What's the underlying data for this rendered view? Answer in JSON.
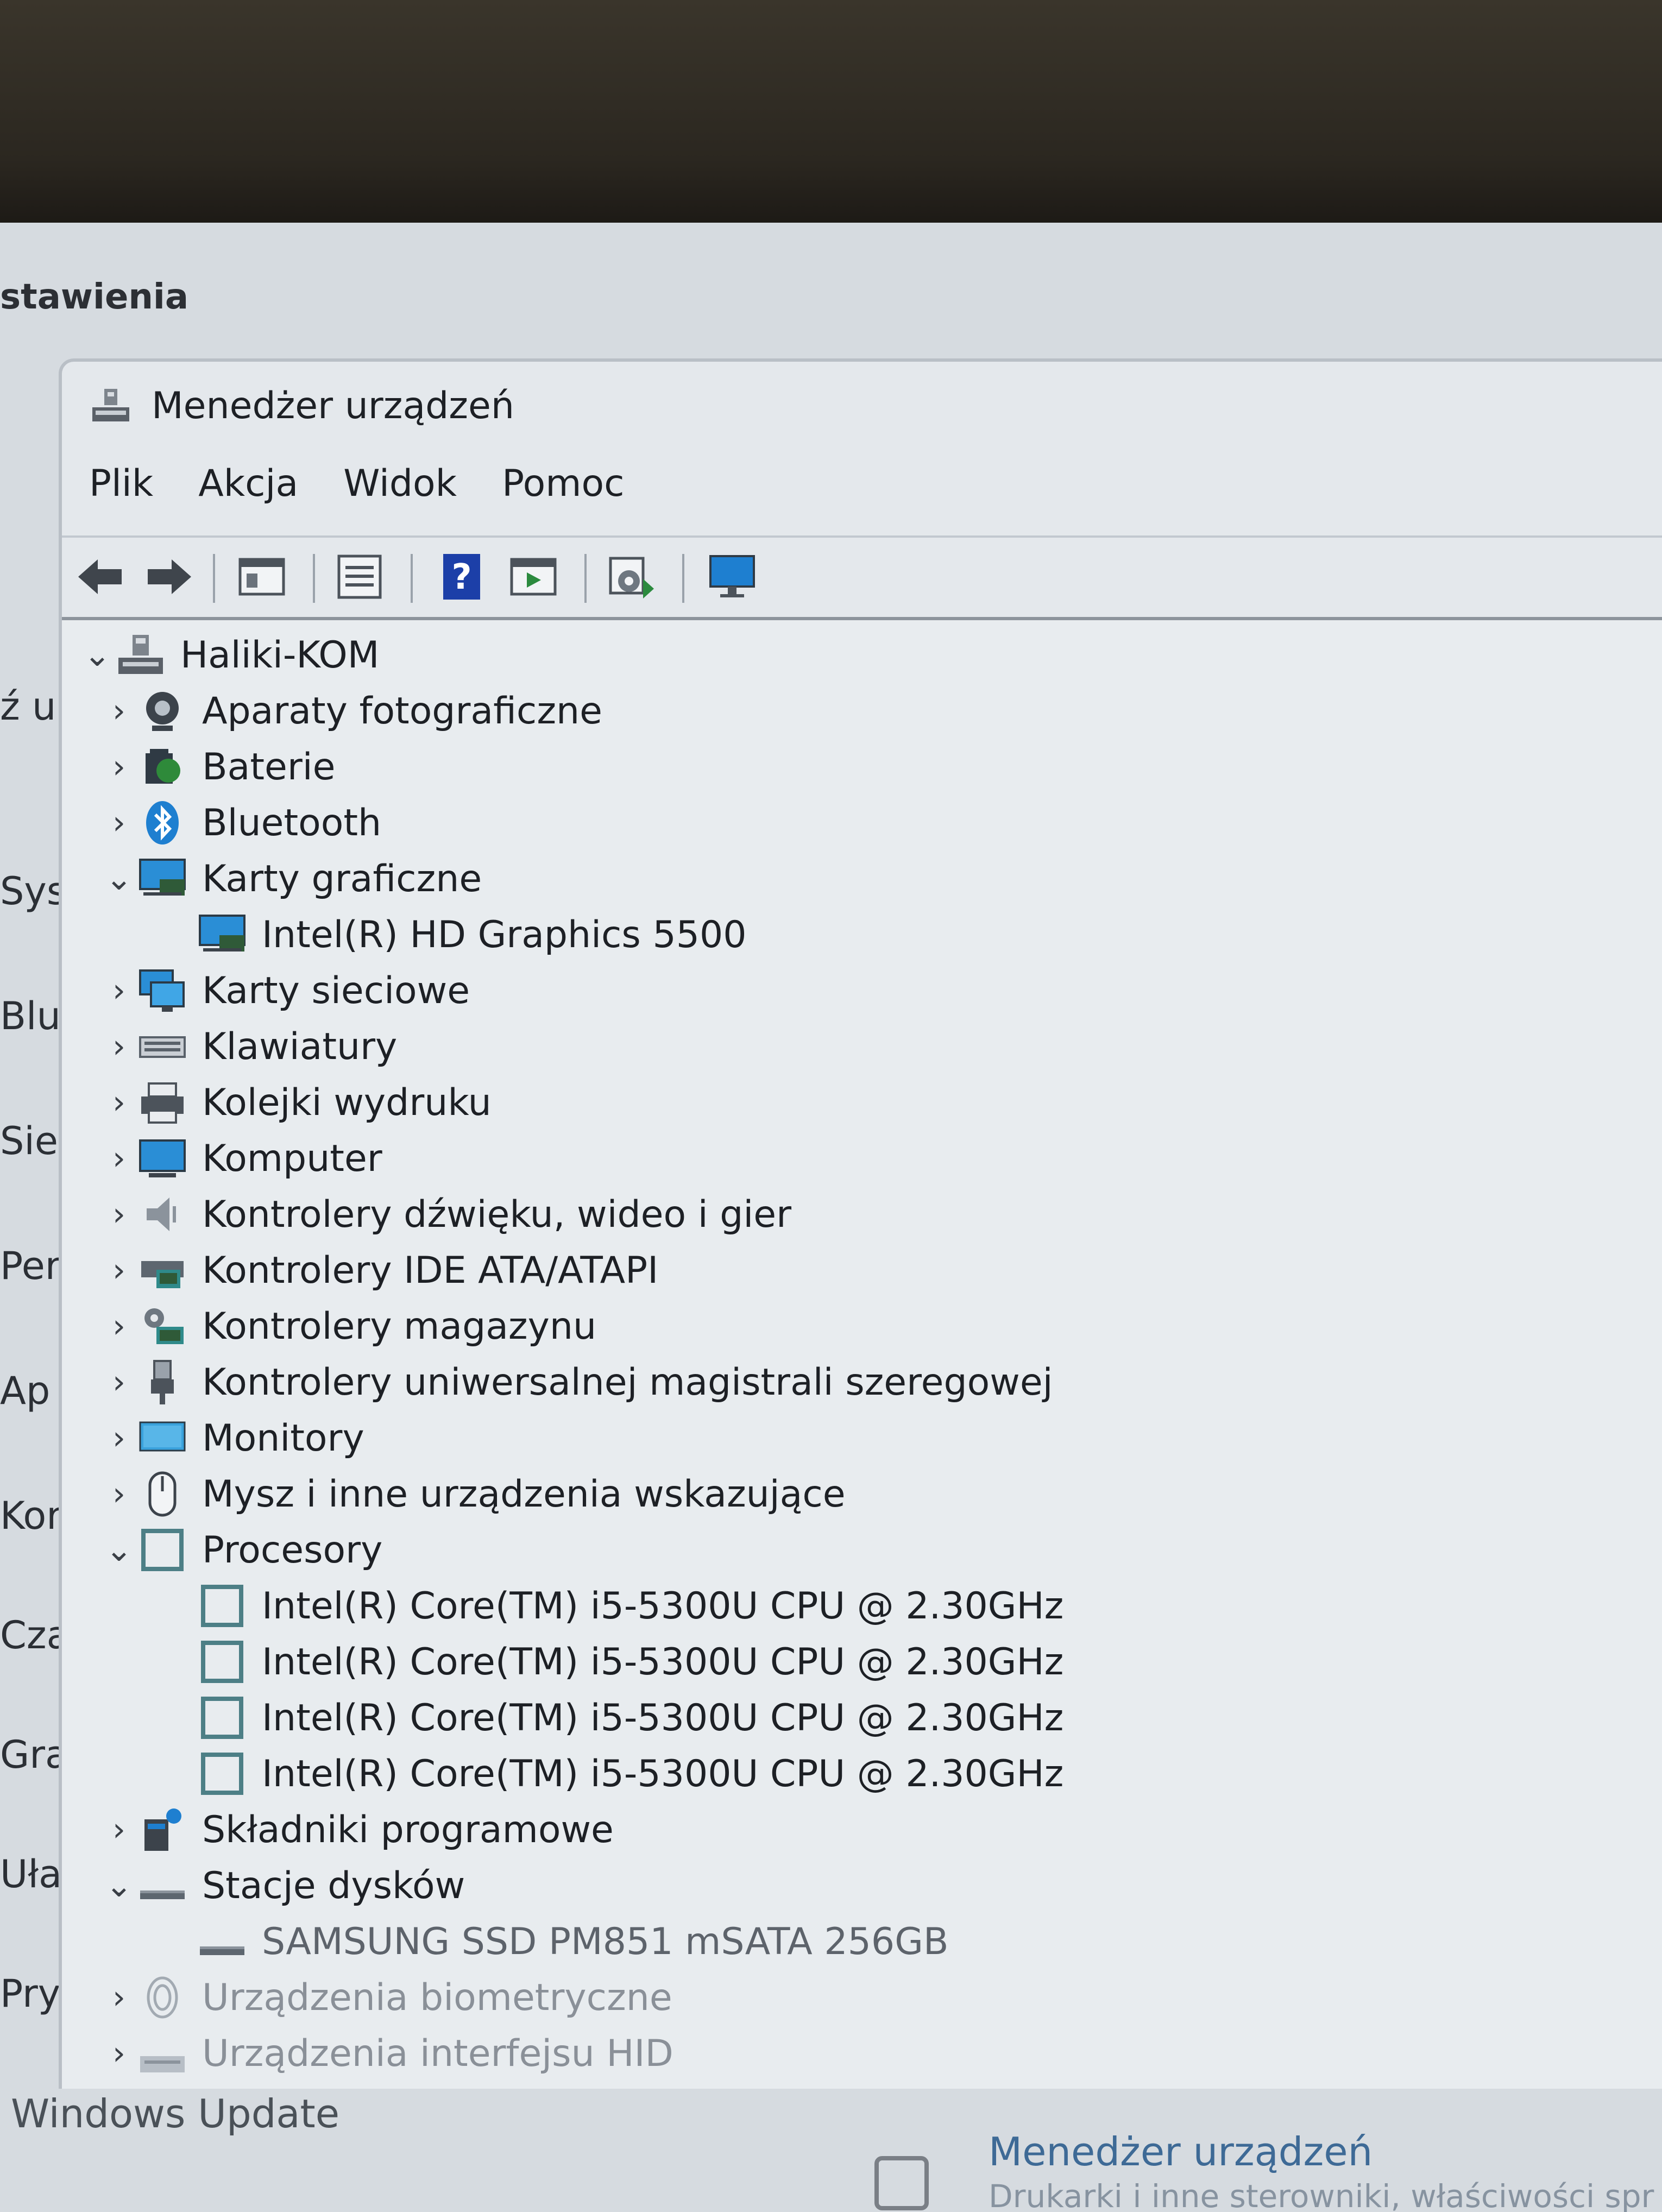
{
  "settings": {
    "title": "stawienia",
    "side_items": [
      "ź u",
      "Sys",
      "Blu",
      "Sie",
      "Per",
      "Ap",
      "Kor",
      "Cza",
      "Gra",
      "Uła",
      "Pry"
    ],
    "windows_update": "Windows Update",
    "bottom_link": "Menedżer urządzeń",
    "bottom_sub": "Drukarki i inne sterowniki, właściwości spr"
  },
  "device_manager": {
    "title": "Menedżer urządzeń",
    "menu": [
      "Plik",
      "Akcja",
      "Widok",
      "Pomoc"
    ],
    "toolbar": [
      "back-icon",
      "forward-icon",
      "properties-view-icon",
      "list-icon",
      "help-icon",
      "run-icon",
      "update-driver-icon",
      "monitor-icon"
    ],
    "root": "Haliki-KOM",
    "tree": [
      {
        "label": "Aparaty fotograficzne",
        "level": 1,
        "state": "collapsed",
        "icon": "camera-icon"
      },
      {
        "label": "Baterie",
        "level": 1,
        "state": "collapsed",
        "icon": "battery-icon"
      },
      {
        "label": "Bluetooth",
        "level": 1,
        "state": "collapsed",
        "icon": "bluetooth-icon"
      },
      {
        "label": "Karty graficzne",
        "level": 1,
        "state": "expanded",
        "icon": "display-adapter-icon"
      },
      {
        "label": "Intel(R) HD Graphics 5500",
        "level": 2,
        "state": "leaf",
        "icon": "display-adapter-icon"
      },
      {
        "label": "Karty sieciowe",
        "level": 1,
        "state": "collapsed",
        "icon": "network-icon"
      },
      {
        "label": "Klawiatury",
        "level": 1,
        "state": "collapsed",
        "icon": "keyboard-icon"
      },
      {
        "label": "Kolejki wydruku",
        "level": 1,
        "state": "collapsed",
        "icon": "printer-icon"
      },
      {
        "label": "Komputer",
        "level": 1,
        "state": "collapsed",
        "icon": "computer-icon"
      },
      {
        "label": "Kontrolery dźwięku, wideo i gier",
        "level": 1,
        "state": "collapsed",
        "icon": "speaker-icon"
      },
      {
        "label": "Kontrolery IDE ATA/ATAPI",
        "level": 1,
        "state": "collapsed",
        "icon": "ide-controller-icon"
      },
      {
        "label": "Kontrolery magazynu",
        "level": 1,
        "state": "collapsed",
        "icon": "storage-controller-icon"
      },
      {
        "label": "Kontrolery uniwersalnej magistrali szeregowej",
        "level": 1,
        "state": "collapsed",
        "icon": "usb-icon"
      },
      {
        "label": "Monitory",
        "level": 1,
        "state": "collapsed",
        "icon": "monitor-icon"
      },
      {
        "label": "Mysz i inne urządzenia wskazujące",
        "level": 1,
        "state": "collapsed",
        "icon": "mouse-icon"
      },
      {
        "label": "Procesory",
        "level": 1,
        "state": "expanded",
        "icon": "processor-icon"
      },
      {
        "label": "Intel(R) Core(TM) i5-5300U CPU @ 2.30GHz",
        "level": 2,
        "state": "leaf",
        "icon": "processor-icon"
      },
      {
        "label": "Intel(R) Core(TM) i5-5300U CPU @ 2.30GHz",
        "level": 2,
        "state": "leaf",
        "icon": "processor-icon"
      },
      {
        "label": "Intel(R) Core(TM) i5-5300U CPU @ 2.30GHz",
        "level": 2,
        "state": "leaf",
        "icon": "processor-icon"
      },
      {
        "label": "Intel(R) Core(TM) i5-5300U CPU @ 2.30GHz",
        "level": 2,
        "state": "leaf",
        "icon": "processor-icon"
      },
      {
        "label": "Składniki programowe",
        "level": 1,
        "state": "collapsed",
        "icon": "software-component-icon"
      },
      {
        "label": "Stacje dysków",
        "level": 1,
        "state": "expanded",
        "icon": "disk-drive-icon"
      },
      {
        "label": "SAMSUNG SSD PM851 mSATA 256GB",
        "level": 2,
        "state": "leaf",
        "icon": "disk-drive-icon"
      },
      {
        "label": "Urządzenia biometryczne",
        "level": 1,
        "state": "collapsed",
        "icon": "biometric-icon"
      },
      {
        "label": "Urządzenia interfejsu HID",
        "level": 1,
        "state": "collapsed",
        "icon": "hid-icon"
      }
    ]
  },
  "colors": {
    "accent": "#1e7fd0",
    "window_bg": "#e8ecef",
    "text": "#1d2025"
  }
}
